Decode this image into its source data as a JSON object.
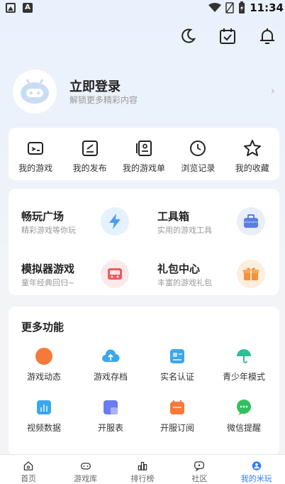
{
  "status_bar": {
    "time": "11:34"
  },
  "profile": {
    "title": "立即登录",
    "subtitle": "解锁更多精彩内容",
    "arrow": "›"
  },
  "quick": [
    {
      "label": "我的游戏",
      "icon": "gamepad-icon"
    },
    {
      "label": "我的发布",
      "icon": "publish-icon"
    },
    {
      "label": "我的游戏单",
      "icon": "game-list-icon"
    },
    {
      "label": "浏览记录",
      "icon": "history-icon"
    },
    {
      "label": "我的收藏",
      "icon": "star-icon"
    }
  ],
  "features": [
    {
      "title": "畅玩广场",
      "subtitle": "精彩游戏等你玩",
      "icon": "lightning-icon",
      "color": "#4a9cf7",
      "bg": "#e6f1fe"
    },
    {
      "title": "工具箱",
      "subtitle": "实用的游戏工具",
      "icon": "toolbox-icon",
      "color": "#5b7fe0",
      "bg": "#e8eefc"
    },
    {
      "title": "模拟器游戏",
      "subtitle": "童年经典回归~",
      "icon": "emulator-icon",
      "color": "#f05a5a",
      "bg": "#fde9e9"
    },
    {
      "title": "礼包中心",
      "subtitle": "丰富的游戏礼包",
      "icon": "gift-icon",
      "color": "#f7913a",
      "bg": "#fdeedd"
    }
  ],
  "more": {
    "title": "更多功能",
    "items": [
      {
        "label": "游戏动态",
        "icon": "game-news-icon",
        "color": "#f47a3c"
      },
      {
        "label": "游戏存档",
        "icon": "cloud-save-icon",
        "color": "#3aa7ee"
      },
      {
        "label": "实名认证",
        "icon": "id-verify-icon",
        "color": "#3aa7ee"
      },
      {
        "label": "青少年模式",
        "icon": "umbrella-icon",
        "color": "#2cbf9a"
      },
      {
        "label": "视频数据",
        "icon": "video-data-icon",
        "color": "#3aa7ee"
      },
      {
        "label": "开服表",
        "icon": "server-list-icon",
        "color": "#6b7cf0"
      },
      {
        "label": "开服订阅",
        "icon": "server-subscribe-icon",
        "color": "#f47a3c"
      },
      {
        "label": "微信提醒",
        "icon": "wechat-icon",
        "color": "#32c05e"
      }
    ]
  },
  "nav": [
    {
      "label": "首页",
      "icon": "home-icon"
    },
    {
      "label": "游戏库",
      "icon": "game-library-icon"
    },
    {
      "label": "排行榜",
      "icon": "ranking-icon"
    },
    {
      "label": "社区",
      "icon": "community-icon"
    },
    {
      "label": "我的米玩",
      "icon": "profile-icon",
      "active": true
    }
  ],
  "colors": {
    "accent": "#2d7df6"
  }
}
